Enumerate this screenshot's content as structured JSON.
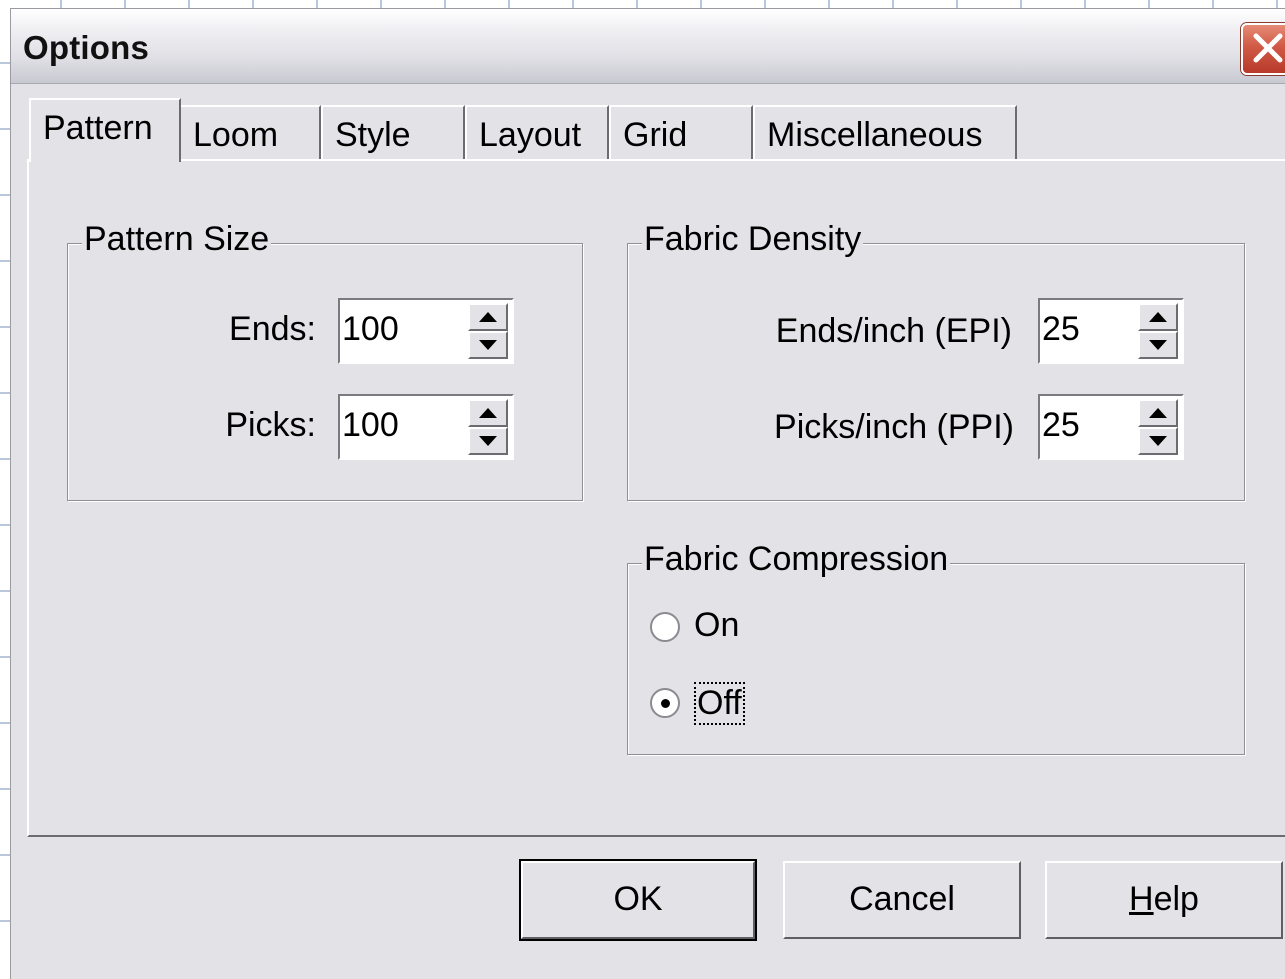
{
  "window": {
    "title": "Options"
  },
  "tabs": [
    {
      "label": "Pattern",
      "active": true
    },
    {
      "label": "Loom",
      "active": false
    },
    {
      "label": "Style",
      "active": false
    },
    {
      "label": "Layout",
      "active": false
    },
    {
      "label": "Grid",
      "active": false
    },
    {
      "label": "Miscellaneous",
      "active": false
    }
  ],
  "pattern_size": {
    "legend": "Pattern Size",
    "ends_label": "Ends:",
    "ends_value": "100",
    "picks_label": "Picks:",
    "picks_value": "100"
  },
  "fabric_density": {
    "legend": "Fabric Density",
    "epi_label": "Ends/inch (EPI)",
    "epi_value": "25",
    "ppi_label": "Picks/inch (PPI)",
    "ppi_value": "25"
  },
  "fabric_compression": {
    "legend": "Fabric Compression",
    "on_label": "On",
    "off_label": "Off",
    "selected": "Off"
  },
  "buttons": {
    "ok": "OK",
    "cancel": "Cancel",
    "help_prefix": "H",
    "help_rest": "elp"
  },
  "colors": {
    "dialog_bg": "#e3e2e7",
    "close_button": "#d05a45"
  },
  "icons": {
    "close": "close-x-icon",
    "spin_up": "triangle-up-icon",
    "spin_down": "triangle-down-icon"
  }
}
